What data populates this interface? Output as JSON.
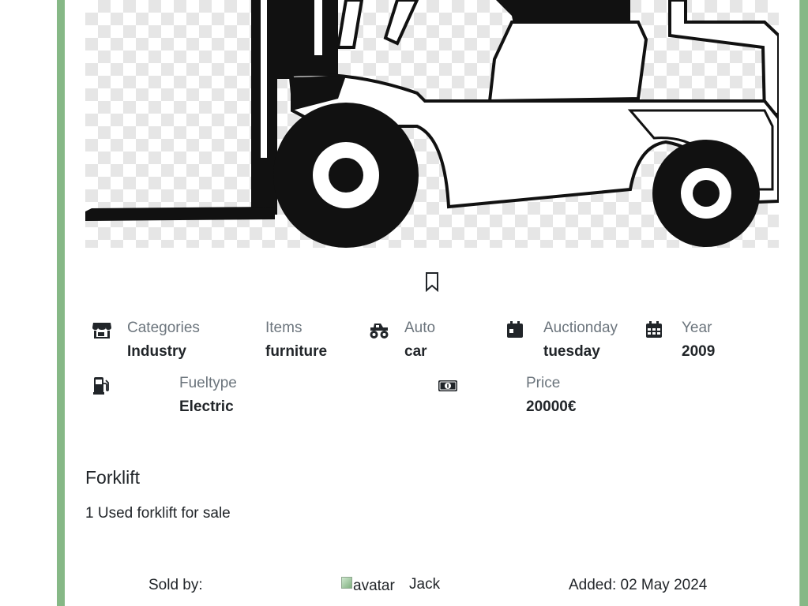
{
  "listing": {
    "title": "Forklift",
    "description": "1 Used forklift for sale",
    "bookmark_icon": "bookmark-icon"
  },
  "specs": {
    "categories": {
      "icon": "shop-icon",
      "label": "Categories",
      "value": "Industry"
    },
    "items": {
      "label": "Items",
      "value": "furniture"
    },
    "auto": {
      "icon": "monster-truck-icon",
      "label": "Auto",
      "value": "car"
    },
    "auctionday": {
      "icon": "calendar-day-icon",
      "label": "Auctionday",
      "value": "tuesday"
    },
    "year": {
      "icon": "calendar-grid-icon",
      "label": "Year",
      "value": "2009"
    },
    "fueltype": {
      "icon": "fuel-pump-icon",
      "label": "Fueltype",
      "value": "Electric"
    },
    "price": {
      "icon": "cash-icon",
      "label": "Price",
      "value": "20000€"
    }
  },
  "footer": {
    "sold_by_label": "Sold by:",
    "avatar_alt": "avatar",
    "seller_name": "Jack",
    "added_label": "Added: 02 May 2024"
  },
  "colors": {
    "frame_green": "#86b886",
    "label_gray": "#6c757d",
    "text_dark": "#212529"
  }
}
